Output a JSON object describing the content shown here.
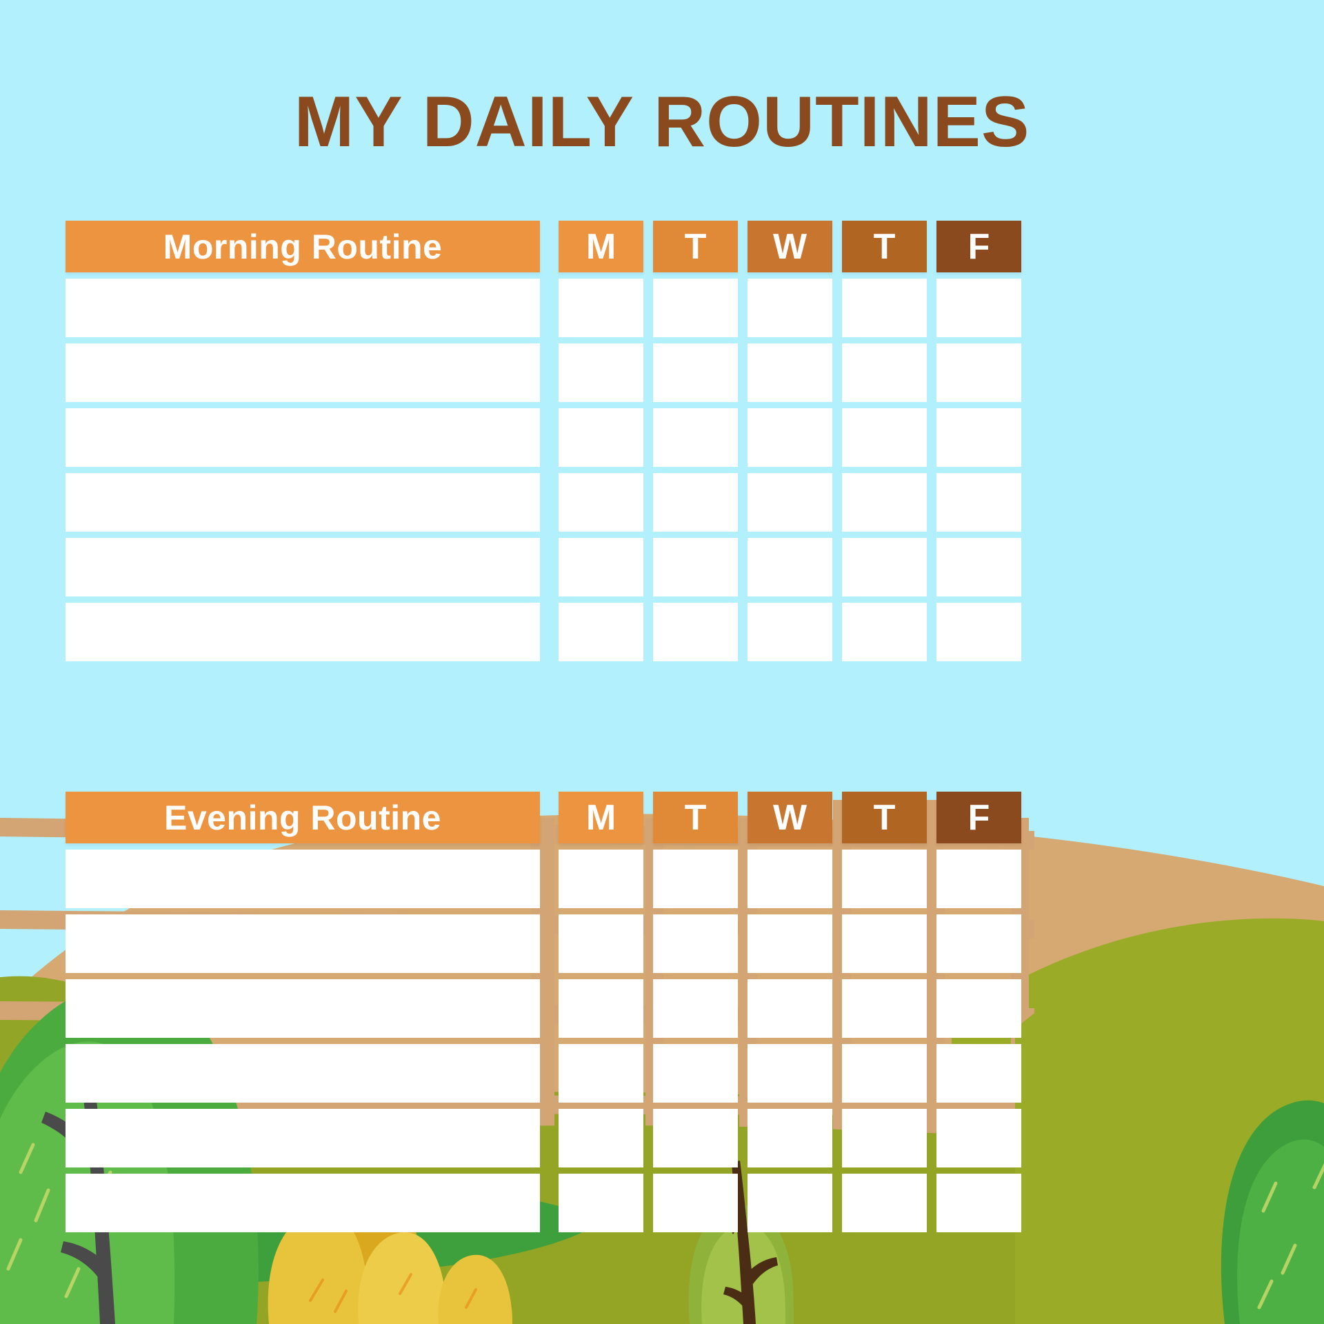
{
  "page": {
    "title": "MY DAILY ROUTINES",
    "background_color": "#b3f0fd",
    "title_color": "#8a4a1e"
  },
  "palette": {
    "sky": "#b3f0fd",
    "cell_white": "#ffffff",
    "day_1": "#ed9440",
    "day_2": "#e08a38",
    "day_3": "#c8762f",
    "day_4": "#b06522",
    "day_5": "#8a4a1e",
    "label_header": "#ed9440",
    "fence": "#d3a474",
    "hill_tan": "#d6a972",
    "hill_olive": "#9aab28",
    "hill_olive_dark": "#8fa024",
    "grass_green": "#3da03c",
    "bush_green": "#4cab3f",
    "bush_green_dark": "#2f8f36",
    "bush_yellow": "#e8c33c",
    "bush_yellow_dark": "#d9a81f",
    "trunk": "#4a4a4a",
    "trunk_brown": "#5a3a1a"
  },
  "tables": [
    {
      "id": "morning",
      "label": "Morning Routine",
      "days": [
        "M",
        "T",
        "W",
        "T",
        "F"
      ],
      "row_count": 6,
      "rows": [
        {
          "task": "",
          "checks": [
            "",
            "",
            "",
            "",
            ""
          ]
        },
        {
          "task": "",
          "checks": [
            "",
            "",
            "",
            "",
            ""
          ]
        },
        {
          "task": "",
          "checks": [
            "",
            "",
            "",
            "",
            ""
          ]
        },
        {
          "task": "",
          "checks": [
            "",
            "",
            "",
            "",
            ""
          ]
        },
        {
          "task": "",
          "checks": [
            "",
            "",
            "",
            "",
            ""
          ]
        },
        {
          "task": "",
          "checks": [
            "",
            "",
            "",
            "",
            ""
          ]
        }
      ]
    },
    {
      "id": "evening",
      "label": "Evening Routine",
      "days": [
        "M",
        "T",
        "W",
        "T",
        "F"
      ],
      "row_count": 6,
      "rows": [
        {
          "task": "",
          "checks": [
            "",
            "",
            "",
            "",
            ""
          ]
        },
        {
          "task": "",
          "checks": [
            "",
            "",
            "",
            "",
            ""
          ]
        },
        {
          "task": "",
          "checks": [
            "",
            "",
            "",
            "",
            ""
          ]
        },
        {
          "task": "",
          "checks": [
            "",
            "",
            "",
            "",
            ""
          ]
        },
        {
          "task": "",
          "checks": [
            "",
            "",
            "",
            "",
            ""
          ]
        },
        {
          "task": "",
          "checks": [
            "",
            "",
            "",
            "",
            ""
          ]
        }
      ]
    }
  ],
  "decoration": {
    "name": "nature-landscape-illustration",
    "elements": [
      "sand-hill",
      "olive-hill",
      "green-bush",
      "tree-branch",
      "yellow-bush",
      "wooden-fence",
      "grass"
    ]
  }
}
